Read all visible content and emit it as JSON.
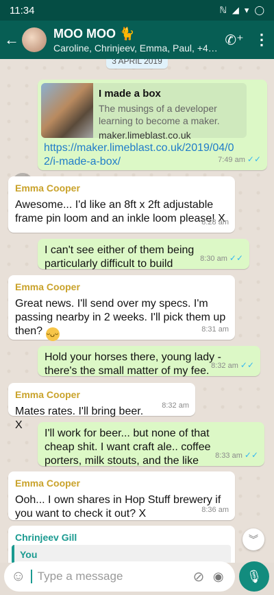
{
  "status_bar": {
    "time": "11:34",
    "icons": [
      "nfc-icon",
      "signal-icon",
      "wifi-icon",
      "battery-icon"
    ]
  },
  "header": {
    "title": "MOO MOO 🐈",
    "members": "Caroline, Chrinjeev, Emma, Paul, +44 78..."
  },
  "date_chip": "3 APRIL 2019",
  "messages": [
    {
      "type": "out",
      "link_preview": {
        "title": "I made a box",
        "description": "The musings of a developer learning to become a maker.",
        "domain": "maker.limeblast.co.uk"
      },
      "text": "https://maker.limeblast.co.uk/2019/04/02/i-made-a-box/",
      "time": "7:49 am",
      "status": "read"
    },
    {
      "type": "in",
      "sender": "Emma Cooper",
      "text": "Awesome... I'd like an 8ft x 2ft adjustable frame pin loom and an inkle loom please! X",
      "time": "8:28 am"
    },
    {
      "type": "out",
      "text": "I can't see either of them being particularly difficult to build",
      "time": "8:30 am",
      "status": "read"
    },
    {
      "type": "in",
      "sender": "Emma Cooper",
      "text": "Great news. I'll send over my specs. I'm passing nearby in 2 weeks. I'll pick them up then?",
      "emoji": "😁",
      "time": "8:31 am"
    },
    {
      "type": "out",
      "text": "Hold your horses there, young lady - there's the small matter of my fee.",
      "time": "8:32 am",
      "status": "read"
    },
    {
      "type": "in",
      "sender": "Emma Cooper",
      "text": "Mates rates. I'll bring beer. X",
      "time": "8:32 am"
    },
    {
      "type": "out",
      "text": "I'll work for beer... but none of that cheap shit. I want craft ale.. coffee porters, milk stouts, and the like",
      "time": "8:33 am",
      "status": "read"
    },
    {
      "type": "in",
      "sender": "Emma Cooper",
      "text": "Ooh... I own shares in Hop Stuff brewery if you want to check it out? X",
      "time": "8:36 am"
    },
    {
      "type": "in",
      "sender": "Chrinjeev Gill",
      "quote_name": "You"
    }
  ],
  "input": {
    "placeholder": "Type a message"
  },
  "colors": {
    "header": "#075e54",
    "status_bar": "#054d44",
    "outgoing": "#dcf8c6",
    "incoming": "#ffffff",
    "mic": "#128c7e",
    "tick": "#34b7f1"
  }
}
